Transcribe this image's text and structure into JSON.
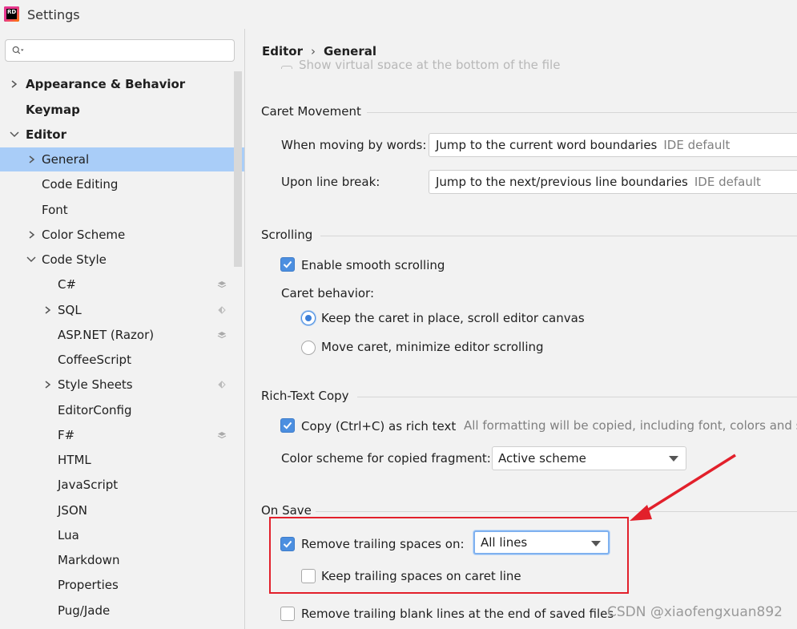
{
  "window": {
    "title": "Settings",
    "logo_text": "RD"
  },
  "sidebar": {
    "search_placeholder": "",
    "items": [
      {
        "label": "Appearance & Behavior"
      },
      {
        "label": "Keymap"
      },
      {
        "label": "Editor"
      },
      {
        "label": "General"
      },
      {
        "label": "Code Editing"
      },
      {
        "label": "Font"
      },
      {
        "label": "Color Scheme"
      },
      {
        "label": "Code Style"
      },
      {
        "label": "C#"
      },
      {
        "label": "SQL"
      },
      {
        "label": "ASP.NET (Razor)"
      },
      {
        "label": "CoffeeScript"
      },
      {
        "label": "Style Sheets"
      },
      {
        "label": "EditorConfig"
      },
      {
        "label": "F#"
      },
      {
        "label": "HTML"
      },
      {
        "label": "JavaScript"
      },
      {
        "label": "JSON"
      },
      {
        "label": "Lua"
      },
      {
        "label": "Markdown"
      },
      {
        "label": "Properties"
      },
      {
        "label": "Pug/Jade"
      }
    ]
  },
  "breadcrumb": {
    "parent": "Editor",
    "sep": "›",
    "current": "General"
  },
  "ghost": {
    "text": "Show virtual space at the bottom of the file"
  },
  "caret_movement": {
    "title": "Caret Movement",
    "words_label": "When moving by words:",
    "words_value": "Jump to the current word boundaries",
    "words_hint": "IDE default",
    "line_label": "Upon line break:",
    "line_value": "Jump to the next/previous line boundaries",
    "line_hint": "IDE default"
  },
  "scrolling": {
    "title": "Scrolling",
    "smooth_label": "Enable smooth scrolling",
    "caret_behavior_label": "Caret behavior:",
    "radio1": "Keep the caret in place, scroll editor canvas",
    "radio2": "Move caret, minimize editor scrolling"
  },
  "rich_text": {
    "title": "Rich-Text Copy",
    "copy_label": "Copy (Ctrl+C) as rich text",
    "copy_hint": "All formatting will be copied, including font, colors and so",
    "scheme_label": "Color scheme for copied fragment:",
    "scheme_value": "Active scheme"
  },
  "on_save": {
    "title": "On Save",
    "trailing_label": "Remove trailing spaces on:",
    "trailing_value": "All lines",
    "keep_label": "Keep trailing spaces on caret line",
    "blank_label": "Remove trailing blank lines at the end of saved files"
  },
  "watermark": "CSDN @xiaofengxuan892",
  "colors": {
    "selection": "#a9cdf8",
    "accent": "#4c8fe0",
    "annotation": "#e2202b"
  }
}
